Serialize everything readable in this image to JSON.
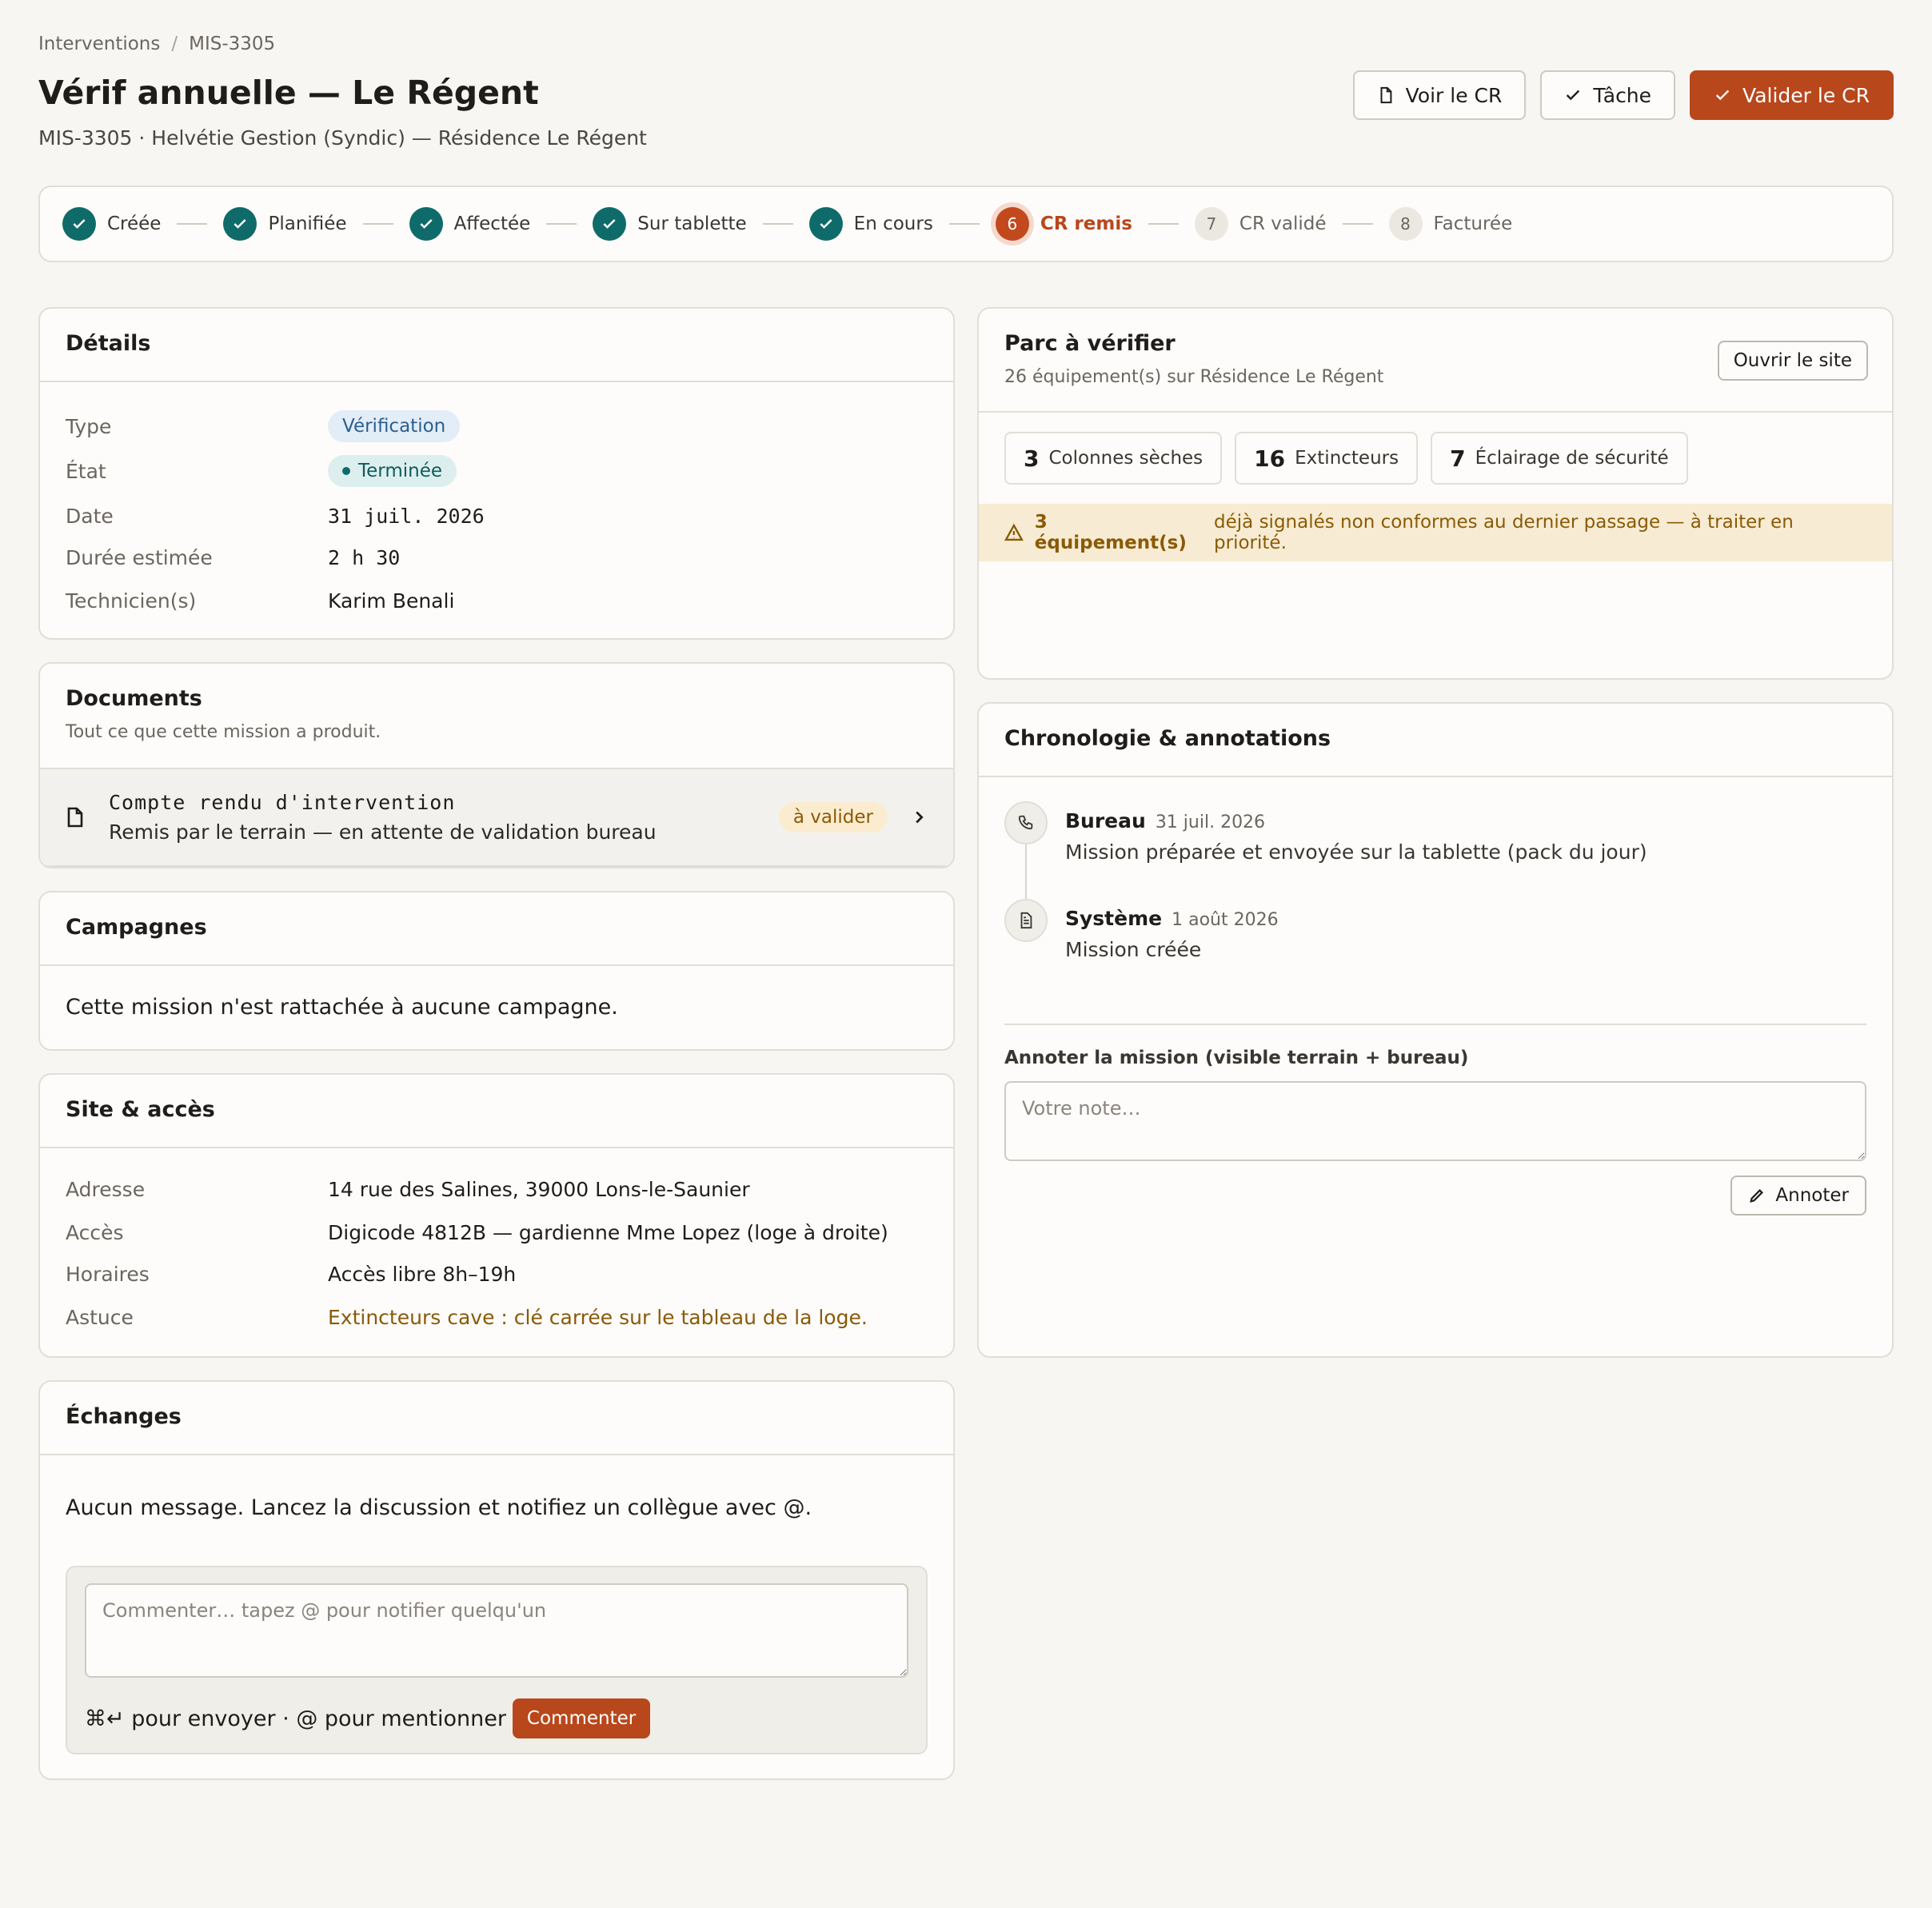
{
  "breadcrumb": {
    "root": "Interventions",
    "current": "MIS-3305"
  },
  "header": {
    "title": "Vérif annuelle — Le Régent",
    "subtitle": "MIS-3305 · Helvétie Gestion (Syndic) — Résidence Le Régent",
    "btn_view_cr": "Voir le CR",
    "btn_task": "Tâche",
    "btn_validate": "Valider le CR"
  },
  "stepper": [
    {
      "label": "Créée",
      "state": "done"
    },
    {
      "label": "Planifiée",
      "state": "done"
    },
    {
      "label": "Affectée",
      "state": "done"
    },
    {
      "label": "Sur tablette",
      "state": "done"
    },
    {
      "label": "En cours",
      "state": "done"
    },
    {
      "label": "CR remis",
      "state": "current",
      "num": "6"
    },
    {
      "label": "CR validé",
      "state": "future",
      "num": "7"
    },
    {
      "label": "Facturée",
      "state": "future",
      "num": "8"
    }
  ],
  "details": {
    "title": "Détails",
    "type_label": "Type",
    "type_value": "Vérification",
    "state_label": "État",
    "state_value": "Terminée",
    "date_label": "Date",
    "date_value": "31 juil. 2026",
    "duration_label": "Durée estimée",
    "duration_value": "2 h 30",
    "tech_label": "Technicien(s)",
    "tech_value": "Karim Benali"
  },
  "documents": {
    "title": "Documents",
    "subtitle": "Tout ce que cette mission a produit.",
    "item_title": "Compte rendu d'intervention",
    "item_desc": "Remis par le terrain — en attente de validation bureau",
    "item_badge": "à valider"
  },
  "campaigns": {
    "title": "Campagnes",
    "empty": "Cette mission n'est rattachée à aucune campagne."
  },
  "site": {
    "title": "Site & accès",
    "address_label": "Adresse",
    "address_value": "14 rue des Salines, 39000 Lons-le-Saunier",
    "access_label": "Accès",
    "access_value": "Digicode 4812B — gardienne Mme Lopez (loge à droite)",
    "hours_label": "Horaires",
    "hours_value": "Accès libre 8h–19h",
    "tip_label": "Astuce",
    "tip_value": "Extincteurs cave : clé carrée sur le tableau de la loge."
  },
  "exchanges": {
    "title": "Échanges",
    "empty": "Aucun message. Lancez la discussion et notifiez un collègue avec @.",
    "placeholder": "Commenter… tapez @ pour notifier quelqu'un",
    "hint": "⌘↵ pour envoyer · @ pour mentionner",
    "button": "Commenter"
  },
  "parc": {
    "title": "Parc à vérifier",
    "subtitle": "26 équipement(s) sur Résidence Le Régent",
    "open_site": "Ouvrir le site",
    "stats": [
      {
        "count": "3",
        "label": "Colonnes sèches"
      },
      {
        "count": "16",
        "label": "Extincteurs"
      },
      {
        "count": "7",
        "label": "Éclairage de sécurité"
      }
    ],
    "warning_strong": "3 équipement(s)",
    "warning_text": "déjà signalés non conformes au dernier passage — à traiter en priorité."
  },
  "timeline": {
    "title": "Chronologie & annotations",
    "items": [
      {
        "author": "Bureau",
        "date": "31 juil. 2026",
        "text": "Mission préparée et envoyée sur la tablette (pack du jour)",
        "icon": "phone-icon"
      },
      {
        "author": "Système",
        "date": "1 août 2026",
        "text": "Mission créée",
        "icon": "document-icon"
      }
    ],
    "annotate_label": "Annoter la mission (visible terrain + bureau)",
    "annotate_placeholder": "Votre note…",
    "annotate_button": "Annoter"
  },
  "colors": {
    "accent": "#b9471c",
    "teal": "#0f6b6a",
    "warning": "#8a5a07"
  }
}
